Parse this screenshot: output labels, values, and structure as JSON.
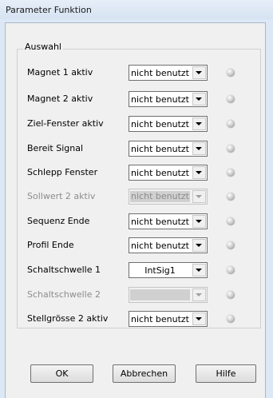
{
  "window": {
    "title": "Parameter Funktion"
  },
  "group": {
    "label": "Auswahl"
  },
  "rows": [
    {
      "label": "Magnet 1 aktiv",
      "value": "nicht benutzt",
      "disabled": false
    },
    {
      "label": "Magnet 2 aktiv",
      "value": "nicht benutzt",
      "disabled": false
    },
    {
      "label": "Ziel-Fenster aktiv",
      "value": "nicht benutzt",
      "disabled": false
    },
    {
      "label": "Bereit Signal",
      "value": "nicht benutzt",
      "disabled": false
    },
    {
      "label": "Schlepp Fenster",
      "value": "nicht benutzt",
      "disabled": false
    },
    {
      "label": "Sollwert 2 aktiv",
      "value": "nicht benutzt",
      "disabled": true
    },
    {
      "label": "Sequenz Ende",
      "value": "nicht benutzt",
      "disabled": false
    },
    {
      "label": "Profil Ende",
      "value": "nicht benutzt",
      "disabled": false
    },
    {
      "label": "Schaltschwelle 1",
      "value": "IntSig1",
      "disabled": false
    },
    {
      "label": "Schaltschwelle 2",
      "value": "",
      "disabled": true
    },
    {
      "label": "Stellgrösse 2 aktiv",
      "value": "nicht benutzt",
      "disabled": false
    }
  ],
  "buttons": {
    "ok": "OK",
    "cancel": "Abbrechen",
    "help": "Hilfe"
  }
}
